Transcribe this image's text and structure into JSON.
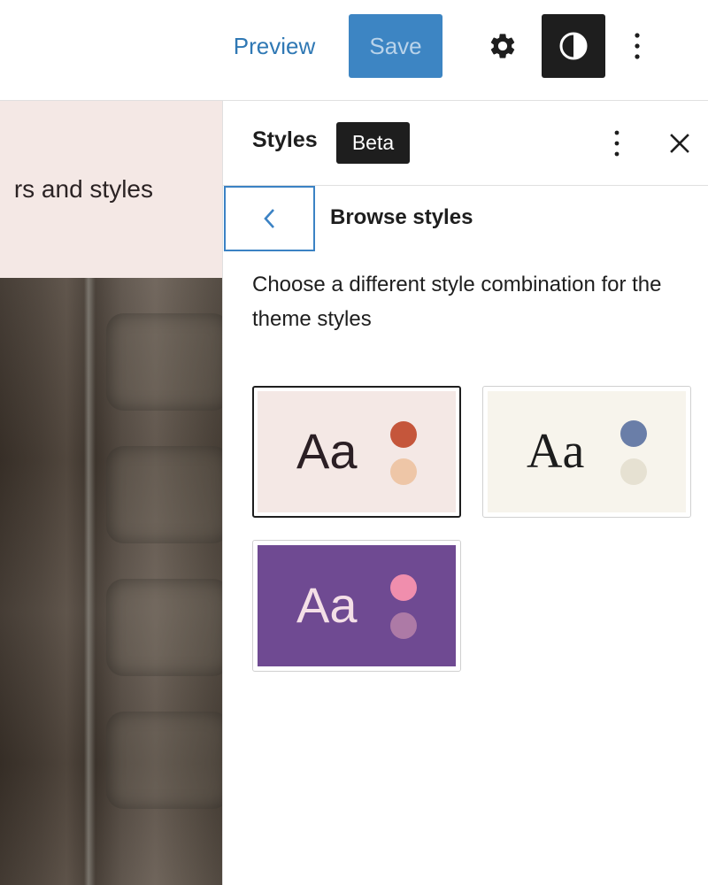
{
  "toolbar": {
    "preview_label": "Preview",
    "save_label": "Save",
    "settings_icon": "gear-icon",
    "styles_icon": "half-circle-contrast-icon",
    "options_icon": "vertical-ellipsis-icon"
  },
  "canvas": {
    "heading_fragment": "rs and styles"
  },
  "sidebar": {
    "title": "Styles",
    "badge": "Beta",
    "options_icon": "vertical-ellipsis-icon",
    "close_icon": "close-icon",
    "back_icon": "chevron-left-icon",
    "nav_title": "Browse styles",
    "description": "Choose a different style combination for the theme styles",
    "variations": [
      {
        "label": "Aa",
        "selected": true,
        "background": "#f4e8e5",
        "text_color": "#2b1f24",
        "primary_dot": "#c5563b",
        "secondary_dot": "#eec6a7"
      },
      {
        "label": "Aa",
        "selected": false,
        "background": "#f7f4ec",
        "text_color": "#1c1c1c",
        "primary_dot": "#6a7ea8",
        "secondary_dot": "#e6e1d2"
      },
      {
        "label": "Aa",
        "selected": false,
        "background": "#6f4a92",
        "text_color": "#f4dfe7",
        "primary_dot": "#f08ead",
        "secondary_dot": "#ad7aa6"
      }
    ]
  }
}
